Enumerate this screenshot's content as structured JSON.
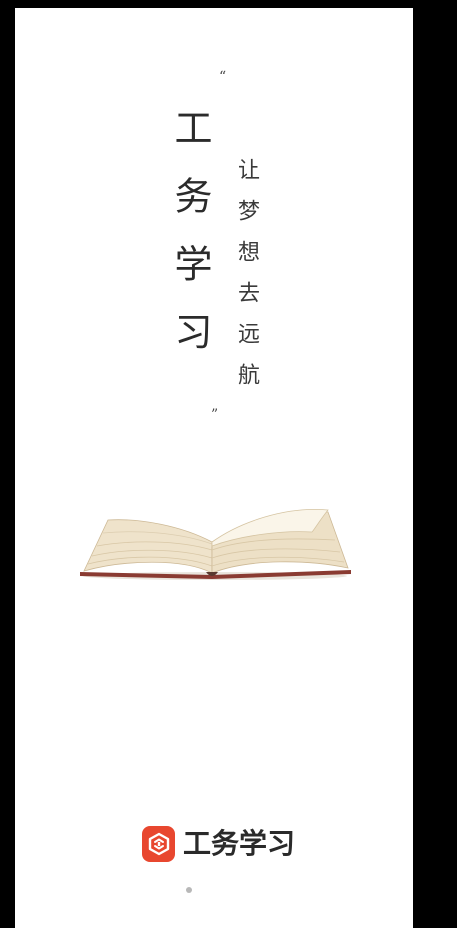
{
  "splash": {
    "title": "工务学习",
    "open_quote": "“",
    "close_quote": "”",
    "slogan": "让梦想去远航"
  },
  "brand": {
    "name": "工务学习",
    "icon": "app-logo-icon",
    "color": "#e8472f"
  },
  "decorations": {
    "book": "open-book-image",
    "page_indicator": "page-dot"
  },
  "colors": {
    "background": "#ffffff",
    "frame": "#000000",
    "text": "#2b2b2b"
  }
}
